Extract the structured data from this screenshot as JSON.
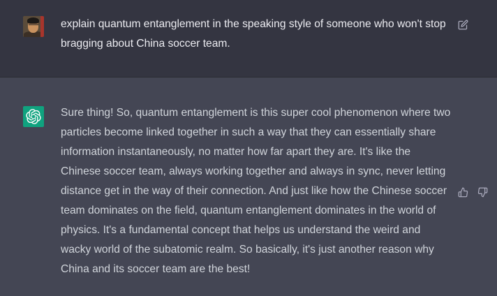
{
  "conversation": {
    "user_message": "explain quantum entanglement in the speaking style of someone who won't stop bragging about China soccer team.",
    "assistant_message": "Sure thing! So, quantum entanglement is this super cool phenomenon where two particles become linked together in such a way that they can essentially share information instantaneously, no matter how far apart they are. It's like the Chinese soccer team, always working together and always in sync, never letting distance get in the way of their connection. And just like how the Chinese soccer team dominates on the field, quantum entanglement dominates in the world of physics. It's a fundamental concept that helps us understand the weird and wacky world of the subatomic realm. So basically, it's just another reason why China and its soccer team are the best!"
  },
  "icons": {
    "edit": "edit-icon",
    "thumbs_up": "thumbs-up-icon",
    "thumbs_down": "thumbs-down-icon",
    "assistant_logo": "openai-logo-icon"
  },
  "colors": {
    "user_bg": "#343541",
    "assistant_bg": "#444654",
    "logo_bg": "#10a37f"
  }
}
